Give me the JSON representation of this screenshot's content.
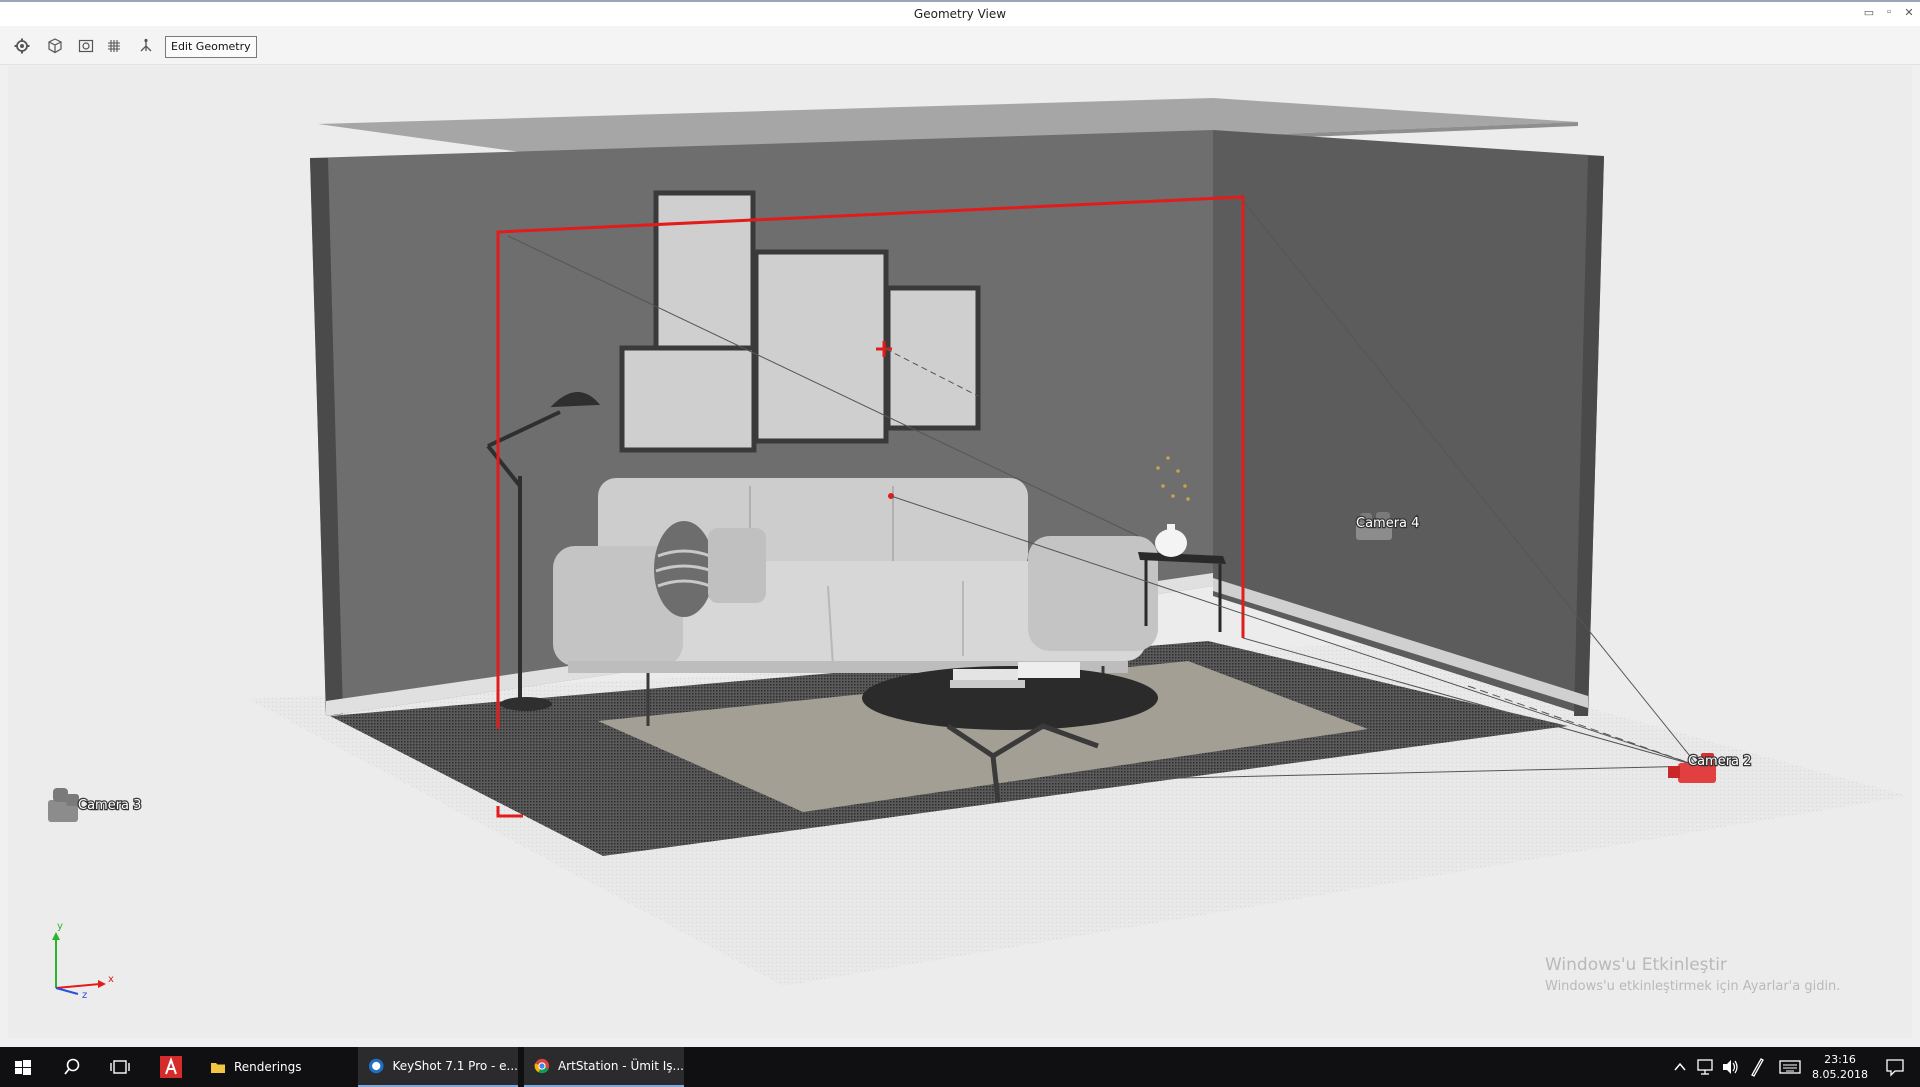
{
  "window": {
    "title": "Geometry View"
  },
  "toolbar": {
    "icons": [
      "gear-icon",
      "cube-icon",
      "camera-view-icon",
      "grid-icon",
      "scene-tree-icon"
    ],
    "edit_geometry_label": "Edit Geometry"
  },
  "viewport": {
    "cameras": [
      {
        "label": "Camera 2"
      },
      {
        "label": "Camera 3"
      },
      {
        "label": "Camera 4"
      }
    ],
    "axes": {
      "y": "y",
      "x": "x",
      "z": "z"
    }
  },
  "watermark": {
    "line1": "Windows'u Etkinleştir",
    "line2": "Windows'u etkinleştirmek için Ayarlar'a gidin."
  },
  "taskbar": {
    "apps": [
      {
        "label": "Renderings",
        "icon": "folder-icon"
      },
      {
        "label": "KeyShot 7.1 Pro - e...",
        "icon": "keyshot-icon"
      },
      {
        "label": "ArtStation - Ümit Iş...",
        "icon": "chrome-icon"
      }
    ],
    "clock": {
      "time": "23:16",
      "date": "8.05.2018"
    }
  },
  "colors": {
    "accent": "#e21b1b",
    "floor": "#ececec",
    "wall": "#666666",
    "taskbar": "#101012"
  }
}
